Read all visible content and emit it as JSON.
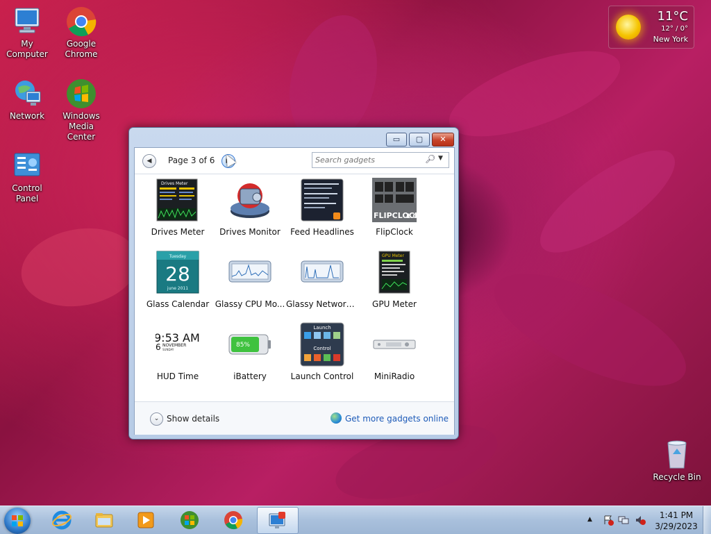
{
  "desktop": {
    "icons": [
      {
        "label": "My Computer",
        "icon": "computer-icon"
      },
      {
        "label": "Google Chrome",
        "icon": "chrome-icon"
      },
      {
        "label": "Network",
        "icon": "network-icon"
      },
      {
        "label": "Windows Media Center",
        "icon": "media-center-icon"
      },
      {
        "label": "Control Panel",
        "icon": "control-panel-icon"
      },
      {
        "label": "Recycle Bin",
        "icon": "recycle-bin-icon"
      }
    ],
    "weather": {
      "temp": "11°C",
      "range": "12° / 0°",
      "city": "New York",
      "icon": "sun-icon"
    }
  },
  "gallery": {
    "min_glyph": "▭",
    "max_glyph": "▢",
    "close_glyph": "✕",
    "prev_glyph": "◀",
    "next_glyph": "▶",
    "page_label": "Page 3 of 6",
    "search_placeholder": "Search gadgets",
    "gadgets": [
      {
        "name": "Drives Meter",
        "icon": "drives-meter-icon"
      },
      {
        "name": "Drives Monitor",
        "icon": "drives-monitor-icon"
      },
      {
        "name": "Feed Headlines",
        "icon": "feed-headlines-icon"
      },
      {
        "name": "FlipClock",
        "icon": "flipclock-icon"
      },
      {
        "name": "Glass Calendar",
        "icon": "calendar-icon"
      },
      {
        "name": "Glassy CPU Mo...",
        "icon": "cpu-monitor-icon"
      },
      {
        "name": "Glassy Network ...",
        "icon": "network-monitor-icon"
      },
      {
        "name": "GPU Meter",
        "icon": "gpu-meter-icon"
      },
      {
        "name": "HUD Time",
        "icon": "hud-time-icon"
      },
      {
        "name": "iBattery",
        "icon": "battery-icon"
      },
      {
        "name": "Launch Control",
        "icon": "launch-control-icon"
      },
      {
        "name": "MiniRadio",
        "icon": "radio-icon"
      }
    ],
    "thumb_text": {
      "drives_meter": "Drives Meter",
      "calendar_day": "Tuesday",
      "calendar_date": "28",
      "calendar_month": "june 2011",
      "hud_time": "9:53 AM",
      "hud_day": "6",
      "hud_month": "NOVEMBER",
      "hud_weekday": "SUNDAY",
      "battery_pct": "85%",
      "launch_top": "Launch",
      "launch_bottom": "Control",
      "flipclock_label": "FLIPCLOCK",
      "flipclock_ver": "1.0",
      "gpu_label": "GPU Meter"
    },
    "details_glyph": "⌄",
    "show_details": "Show details",
    "get_more": "Get more gadgets online"
  },
  "taskbar": {
    "items": [
      {
        "icon": "internet-explorer-icon"
      },
      {
        "icon": "folder-icon"
      },
      {
        "icon": "media-player-icon"
      },
      {
        "icon": "media-center-icon"
      },
      {
        "icon": "chrome-icon"
      },
      {
        "icon": "gadgets-icon"
      }
    ],
    "tray": {
      "expand_glyph": "▲",
      "time": "1:41 PM",
      "date": "3/29/2023"
    }
  }
}
